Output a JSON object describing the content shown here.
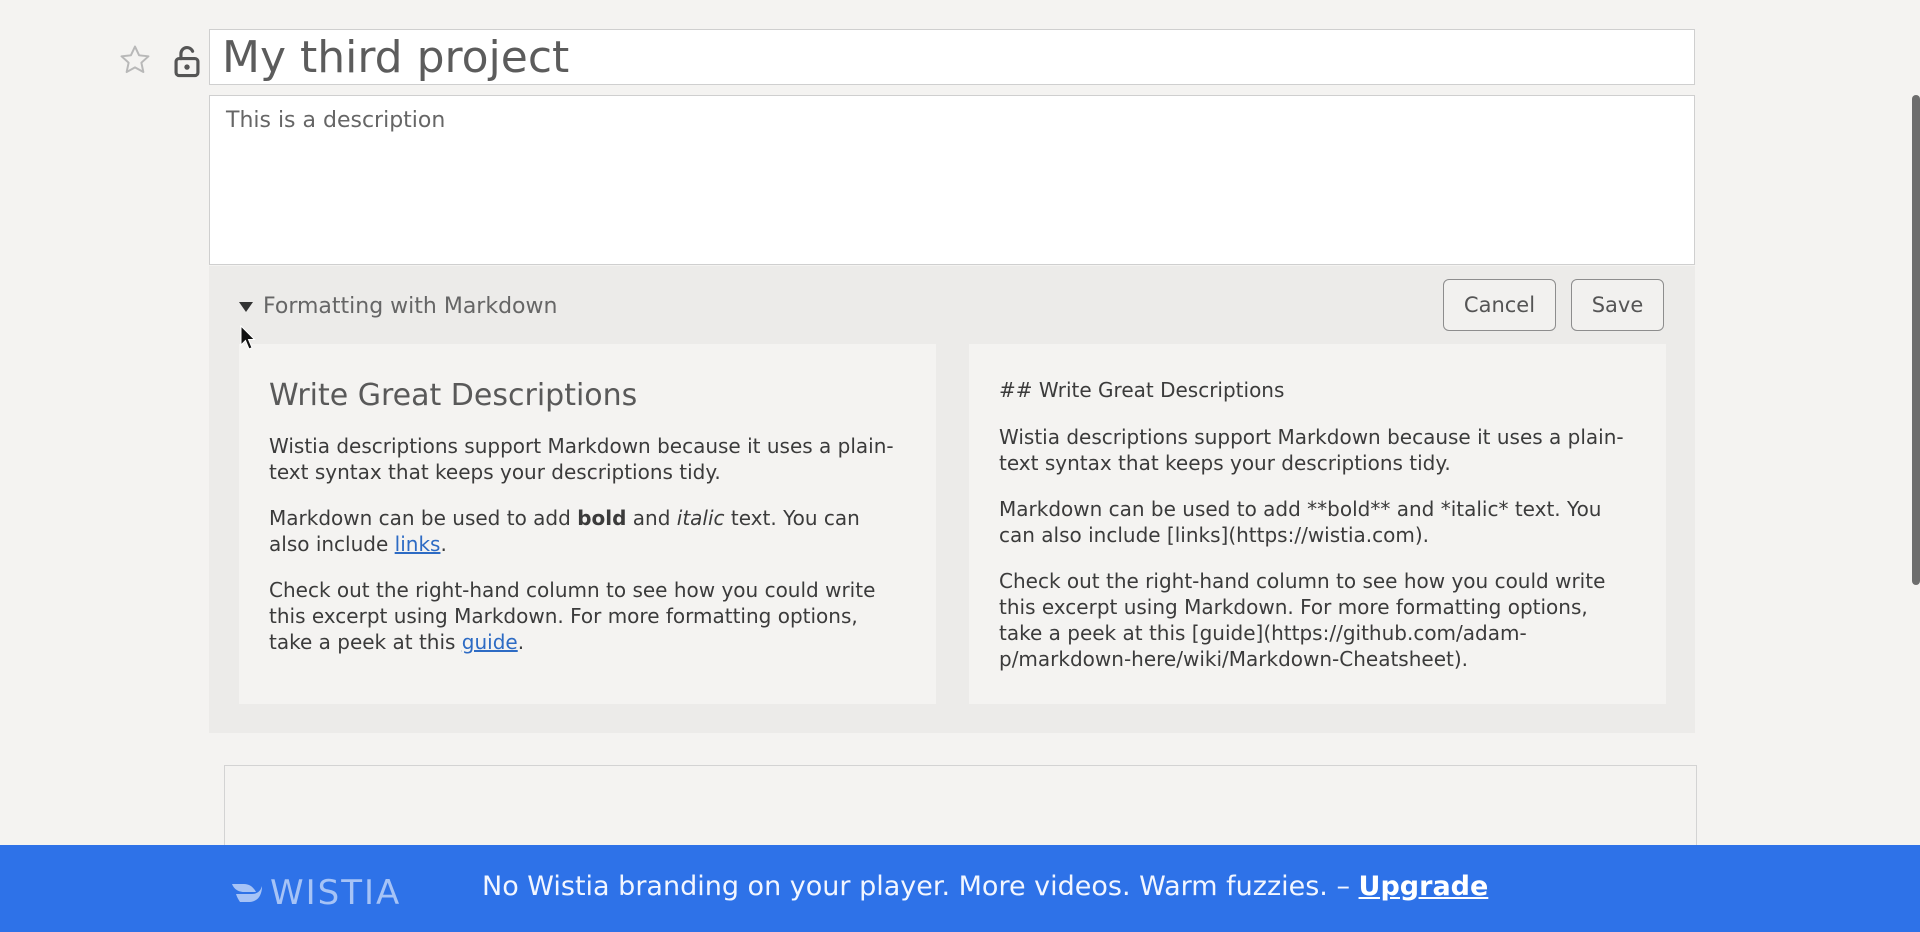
{
  "project": {
    "title": "My third project",
    "description": "This is a description"
  },
  "markdown_help": {
    "toggle_label": "Formatting with Markdown",
    "cancel_label": "Cancel",
    "save_label": "Save",
    "rendered": {
      "heading": "Write Great Descriptions",
      "p1": "Wistia descriptions support Markdown because it uses a plain-text syntax that keeps your descriptions tidy.",
      "p2_a": "Markdown can be used to add ",
      "p2_bold": "bold",
      "p2_b": " and ",
      "p2_italic": "italic",
      "p2_c": " text. You can also include ",
      "p2_link": "links",
      "p2_d": ".",
      "p3_a": "Check out the right-hand column to see how you could write this excerpt using Markdown. For more formatting options, take a peek at this ",
      "p3_link": "guide",
      "p3_b": "."
    },
    "source": {
      "heading": "## Write Great Descriptions",
      "p1": "Wistia descriptions support Markdown because it uses a plain-text syntax that keeps your descriptions tidy.",
      "p2": "Markdown can be used to add **bold** and *italic* text. You can also include [links](https://wistia.com).",
      "p3": "Check out the right-hand column to see how you could write this excerpt using Markdown. For more formatting options, take a peek at this [guide](https://github.com/adam-p/markdown-here/wiki/Markdown-Cheatsheet)."
    }
  },
  "banner": {
    "brand": "WISTIA",
    "message": "No Wistia branding on your player. More videos. Warm fuzzies. – ",
    "upgrade_label": "Upgrade",
    "background": "#2e72e8"
  },
  "icons": {
    "star": "star-icon",
    "lock": "unlock-icon",
    "caret": "caret-down-icon",
    "cursor": "cursor-icon"
  }
}
